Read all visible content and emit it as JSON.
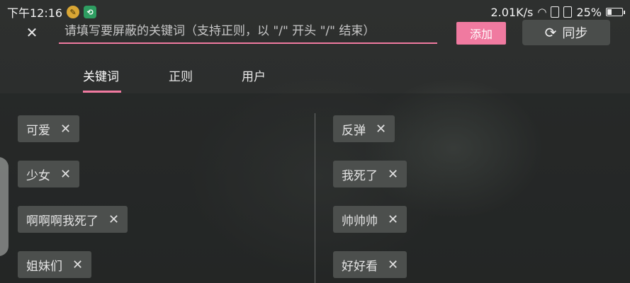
{
  "status_bar": {
    "time": "下午12:16",
    "net_speed": "2.01K/s",
    "battery": "25%",
    "battery_level": 0.25
  },
  "top_bar": {
    "input_placeholder": "请填写要屏蔽的关键词（支持正则，以 \"/\" 开头 \"/\" 结束）",
    "input_value": "",
    "add_label": "添加",
    "sync_label": "同步",
    "accent_color": "#f07aa0"
  },
  "tabs": [
    {
      "label": "关键词",
      "active": true
    },
    {
      "label": "正则",
      "active": false
    },
    {
      "label": "用户",
      "active": false
    }
  ],
  "keywords_left": [
    "可爱",
    "少女",
    "啊啊啊我死了",
    "姐妹们"
  ],
  "keywords_right": [
    "反弹",
    "我死了",
    "帅帅帅",
    "好好看"
  ]
}
